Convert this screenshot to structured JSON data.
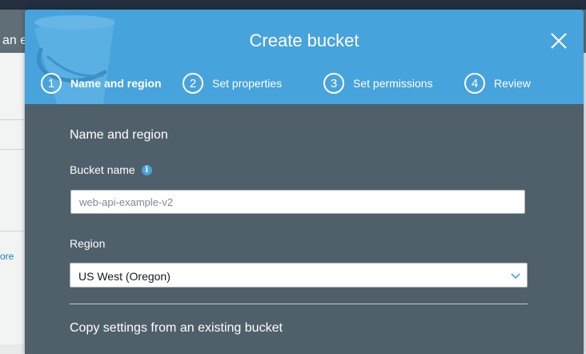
{
  "background": {
    "header_text": "an e",
    "side_link": "ore"
  },
  "modal": {
    "title": "Create bucket",
    "steps": [
      {
        "number": "1",
        "label": "Name and region",
        "active": true
      },
      {
        "number": "2",
        "label": "Set properties",
        "active": false
      },
      {
        "number": "3",
        "label": "Set permissions",
        "active": false
      },
      {
        "number": "4",
        "label": "Review",
        "active": false
      }
    ],
    "section_title": "Name and region",
    "bucket_name": {
      "label": "Bucket name",
      "value": "",
      "placeholder": "web-api-example-v2",
      "info_icon": "info-icon"
    },
    "region": {
      "label": "Region",
      "selected": "US West (Oregon)"
    },
    "copy_settings_title": "Copy settings from an existing bucket"
  },
  "colors": {
    "header_blue": "#47a3dc",
    "modal_body": "#4f606b",
    "page_bg": "#e9eaea"
  }
}
